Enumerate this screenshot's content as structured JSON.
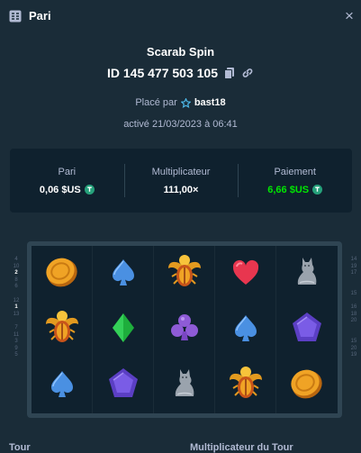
{
  "header": {
    "title": "Pari",
    "title_icon": "bet-slip-icon",
    "close_label": "×"
  },
  "bet": {
    "game_name": "Scarab Spin",
    "id_text": "ID 145 477 503 105",
    "placed_by_label": "Placé par",
    "username": "bast18",
    "activated_text": "activé 21/03/2023 à 06:41"
  },
  "stats": {
    "bet_label": "Pari",
    "bet_value": "0,06 $US",
    "multiplier_label": "Multiplicateur",
    "multiplier_value": "111,00×",
    "payout_label": "Paiement",
    "payout_value": "6,66 $US",
    "payout_color": "#00e701"
  },
  "paylines": {
    "left": [
      "4",
      "10",
      "2",
      "8",
      "6",
      "",
      "12",
      "1",
      "13",
      "",
      "7",
      "11",
      "3",
      "9",
      "5"
    ],
    "right": [
      "14",
      "19",
      "17",
      "",
      "",
      "15",
      "",
      "16",
      "18",
      "20",
      "",
      "",
      "15",
      "20",
      "19"
    ],
    "highlighted": [
      "2",
      "1"
    ]
  },
  "reels": [
    [
      "coin",
      "spade",
      "scarab",
      "heart",
      "cat"
    ],
    [
      "scarab",
      "diamond",
      "club",
      "spade",
      "gem"
    ],
    [
      "spade",
      "gem",
      "cat",
      "scarab",
      "coin"
    ]
  ],
  "footer": {
    "round_label": "Tour",
    "round_multiplier_label": "Multiplicateur du Tour"
  }
}
